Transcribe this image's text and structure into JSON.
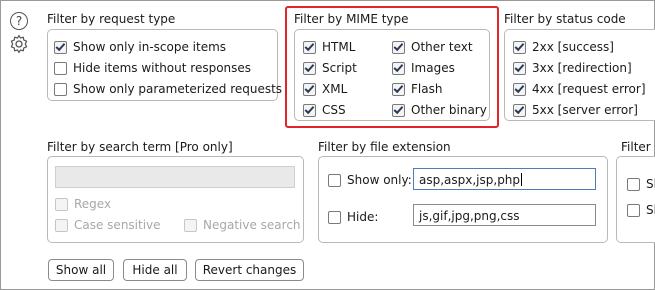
{
  "icons": {
    "help": "?",
    "settings": "۞"
  },
  "request_type": {
    "title": "Filter by request type",
    "items": [
      {
        "label": "Show only in-scope items",
        "checked": true
      },
      {
        "label": "Hide items without responses",
        "checked": false
      },
      {
        "label": "Show only parameterized requests",
        "checked": false
      }
    ]
  },
  "mime": {
    "title": "Filter by MIME type",
    "items": [
      {
        "label": "HTML",
        "checked": true
      },
      {
        "label": "Other text",
        "checked": true
      },
      {
        "label": "Script",
        "checked": true
      },
      {
        "label": "Images",
        "checked": true
      },
      {
        "label": "XML",
        "checked": true
      },
      {
        "label": "Flash",
        "checked": true
      },
      {
        "label": "CSS",
        "checked": true
      },
      {
        "label": "Other binary",
        "checked": true
      }
    ]
  },
  "status": {
    "title": "Filter by status code",
    "items": [
      {
        "code": "2xx",
        "desc": "[success]",
        "checked": true
      },
      {
        "code": "3xx",
        "desc": "[redirection]",
        "checked": true
      },
      {
        "code": "4xx",
        "desc": "[request error]",
        "checked": true
      },
      {
        "code": "5xx",
        "desc": "[server error]",
        "checked": true
      }
    ]
  },
  "search": {
    "title": "Filter by search term [Pro only]",
    "value": "",
    "regex": "Regex",
    "case_sensitive": "Case sensitive",
    "negative": "Negative search"
  },
  "extension": {
    "title": "Filter by file extension",
    "show_label": "Show only:",
    "show_value": "asp,aspx,jsp,php",
    "show_checked": false,
    "hide_label": "Hide:",
    "hide_value": "js,gif,jpg,png,css",
    "hide_checked": false
  },
  "cut": {
    "title_partial": "Filter b",
    "item_partial": "Sh"
  },
  "buttons": {
    "show_all": "Show all",
    "hide_all": "Hide all",
    "revert": "Revert changes"
  },
  "colors": {
    "highlight": "#e0262b",
    "border": "#b9b9b9"
  }
}
